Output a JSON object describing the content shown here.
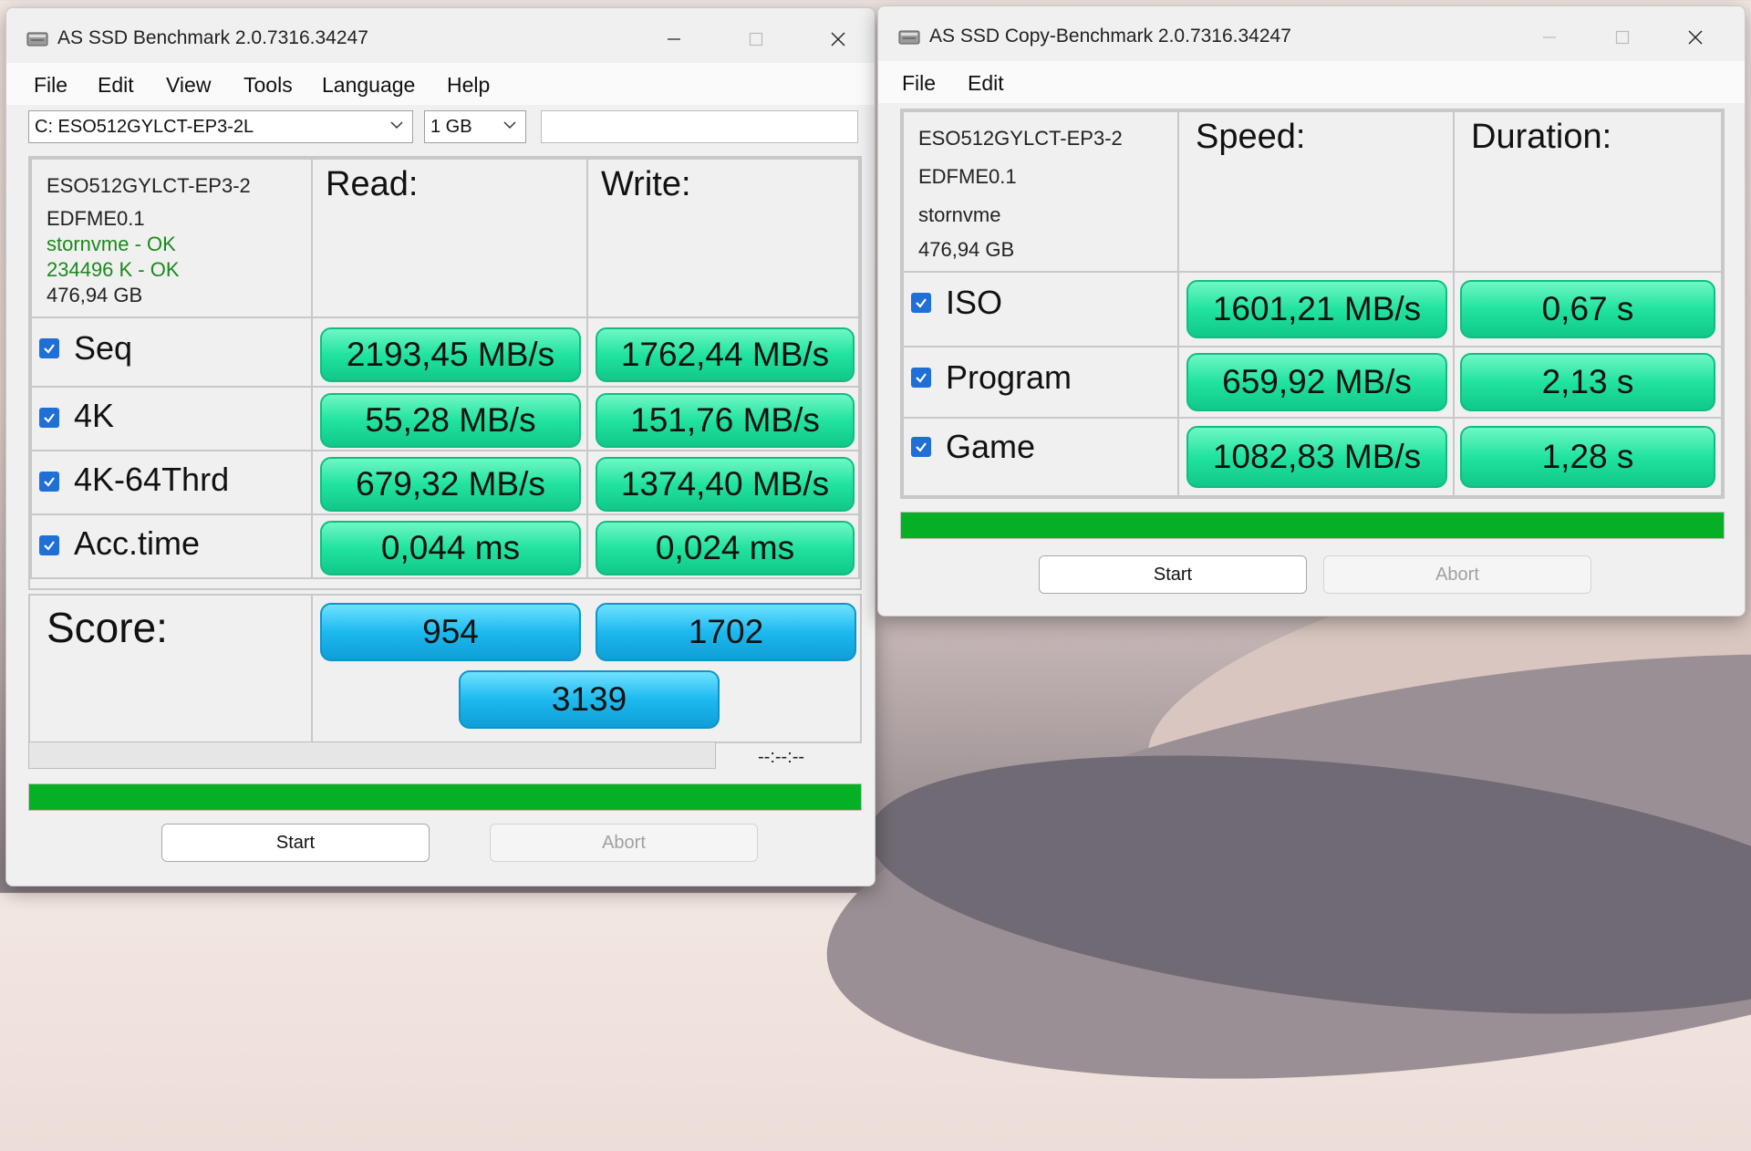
{
  "main": {
    "title": "AS SSD Benchmark 2.0.7316.34247",
    "menu": [
      "File",
      "Edit",
      "View",
      "Tools",
      "Language",
      "Help"
    ],
    "drive_select": "C: ESO512GYLCT-EP3-2L",
    "size_select": "1 GB",
    "info": {
      "model": "ESO512GYLCT-EP3-2",
      "firmware": "EDFME0.1",
      "driver": "stornvme - OK",
      "alignment": "234496 K - OK",
      "capacity": "476,94 GB"
    },
    "headers": {
      "read": "Read:",
      "write": "Write:"
    },
    "rows": [
      {
        "label": "Seq",
        "read": "2193,45 MB/s",
        "write": "1762,44 MB/s"
      },
      {
        "label": "4K",
        "read": "55,28 MB/s",
        "write": "151,76 MB/s"
      },
      {
        "label": "4K-64Thrd",
        "read": "679,32 MB/s",
        "write": "1374,40 MB/s"
      },
      {
        "label": "Acc.time",
        "read": "0,044 ms",
        "write": "0,024 ms"
      }
    ],
    "score": {
      "label": "Score:",
      "read": "954",
      "write": "1702",
      "total": "3139"
    },
    "elapsed": "--:--:--",
    "start": "Start",
    "abort": "Abort"
  },
  "copy": {
    "title": "AS SSD Copy-Benchmark 2.0.7316.34247",
    "menu": [
      "File",
      "Edit"
    ],
    "info": {
      "model": "ESO512GYLCT-EP3-2",
      "firmware": "EDFME0.1",
      "driver": "stornvme",
      "capacity": "476,94 GB"
    },
    "headers": {
      "speed": "Speed:",
      "duration": "Duration:"
    },
    "rows": [
      {
        "label": "ISO",
        "speed": "1601,21 MB/s",
        "duration": "0,67 s"
      },
      {
        "label": "Program",
        "speed": "659,92 MB/s",
        "duration": "2,13 s"
      },
      {
        "label": "Game",
        "speed": "1082,83 MB/s",
        "duration": "1,28 s"
      }
    ],
    "start": "Start",
    "abort": "Abort"
  }
}
